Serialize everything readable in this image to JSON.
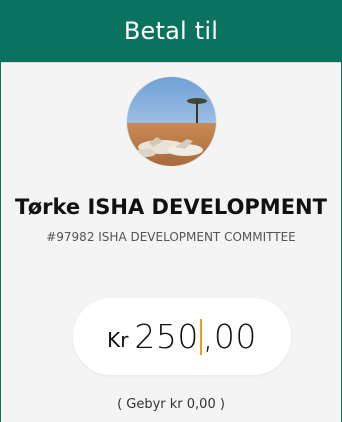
{
  "header": {
    "title": "Betal til"
  },
  "recipient": {
    "name": "Tørke ISHA DEVELOPMENT",
    "subtitle": "#97982 ISHA DEVELOPMENT COMMITTEE"
  },
  "amount": {
    "currency": "Kr",
    "integer": "250",
    "decimal": ",00"
  },
  "fee": {
    "text": "( Gebyr kr 0,00 )"
  },
  "colors": {
    "header_bg": "#0b7260",
    "caret": "#f29a1b"
  }
}
